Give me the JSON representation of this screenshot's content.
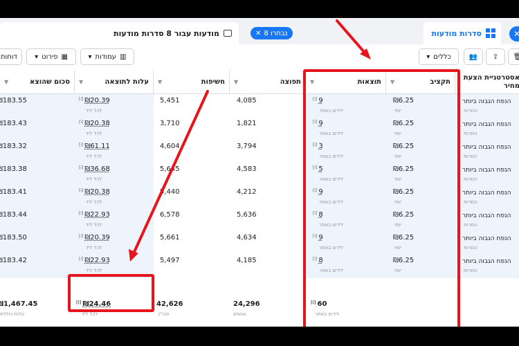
{
  "tabs": {
    "campaign_sets_label": "סדרות מודעות",
    "selected_badge": "8 נבחרו",
    "ads_tab_label": "מודעות עבור 8 סדרות מודעות"
  },
  "toolbar": {
    "rules_label": "כללים",
    "columns_label": "עמודות",
    "breakdown_label": "פירוט",
    "reports_label": "דוחות"
  },
  "columns": {
    "strategy": "אסטרטגיית הצעת מחיר",
    "budget": "תקציב",
    "results": "תוצאות",
    "reach": "תפוצה",
    "impressions": "חשיפות",
    "cost_per_result": "עלות לתוצאה",
    "amount_spent": "סכום שהוצא"
  },
  "rows": [
    {
      "strategy": "הנפח הגבוה ביותר",
      "strategy_sub": "המרות",
      "budget": "₪6.25",
      "budget_sub": "יומי",
      "results": "9",
      "results_sub": "לידים באתר",
      "reach": "4,085",
      "impressions": "5,451",
      "cost": "₪20.39",
      "cost_sub": "לכל ליד",
      "spent": "₪183.55"
    },
    {
      "strategy": "הנפח הגבוה ביותר",
      "strategy_sub": "המרות",
      "budget": "₪6.25",
      "budget_sub": "יומי",
      "results": "9",
      "results_sub": "לידים באתר",
      "reach": "1,821",
      "impressions": "3,710",
      "cost": "₪20.38",
      "cost_sub": "לכל ליד",
      "spent": "₪183.43"
    },
    {
      "strategy": "הנפח הגבוה ביותר",
      "strategy_sub": "המרות",
      "budget": "₪6.25",
      "budget_sub": "יומי",
      "results": "3",
      "results_sub": "לידים באתר",
      "reach": "3,794",
      "impressions": "4,604",
      "cost": "₪61.11",
      "cost_sub": "לכל ליד",
      "spent": "₪183.32"
    },
    {
      "strategy": "הנפח הגבוה ביותר",
      "strategy_sub": "המרות",
      "budget": "₪6.25",
      "budget_sub": "יומי",
      "results": "5",
      "results_sub": "לידים באתר",
      "reach": "4,583",
      "impressions": "5,645",
      "cost": "₪36.68",
      "cost_sub": "לכל ליד",
      "spent": "₪183.38"
    },
    {
      "strategy": "הנפח הגבוה ביותר",
      "strategy_sub": "המרות",
      "budget": "₪6.25",
      "budget_sub": "יומי",
      "results": "9",
      "results_sub": "לידים באתר",
      "reach": "4,212",
      "impressions": "5,440",
      "cost": "₪20.38",
      "cost_sub": "לכל ליד",
      "spent": "₪183.41"
    },
    {
      "strategy": "הנפח הגבוה ביותר",
      "strategy_sub": "המרות",
      "budget": "₪6.25",
      "budget_sub": "יומי",
      "results": "8",
      "results_sub": "לידים באתר",
      "reach": "5,636",
      "impressions": "6,578",
      "cost": "₪22.93",
      "cost_sub": "לכל ליד",
      "spent": "₪183.44"
    },
    {
      "strategy": "הנפח הגבוה ביותר",
      "strategy_sub": "המרות",
      "budget": "₪6.25",
      "budget_sub": "יומי",
      "results": "9",
      "results_sub": "לידים באתר",
      "reach": "4,634",
      "impressions": "5,661",
      "cost": "₪20.39",
      "cost_sub": "לכל ליד",
      "spent": "₪183.50"
    },
    {
      "strategy": "הנפח הגבוה ביותר",
      "strategy_sub": "המרות",
      "budget": "₪6.25",
      "budget_sub": "יומי",
      "results": "8",
      "results_sub": "לידים באתר",
      "reach": "4,185",
      "impressions": "5,497",
      "cost": "₪22.93",
      "cost_sub": "לכל ליד",
      "spent": "₪183.42"
    }
  ],
  "totals": {
    "results": "60",
    "results_sub": "לידים באתר",
    "reach": "24,296",
    "reach_sub": "אנשים",
    "impressions": "42,626",
    "impressions_sub": "סה\"כ",
    "cost": "₪24.46",
    "cost_sub": "לכל ליד",
    "spent": "₪1,467.45",
    "spent_sub": "עלות כוללת"
  },
  "colors": {
    "annotation_red": "#e8141c",
    "brand_blue": "#1877f2"
  }
}
